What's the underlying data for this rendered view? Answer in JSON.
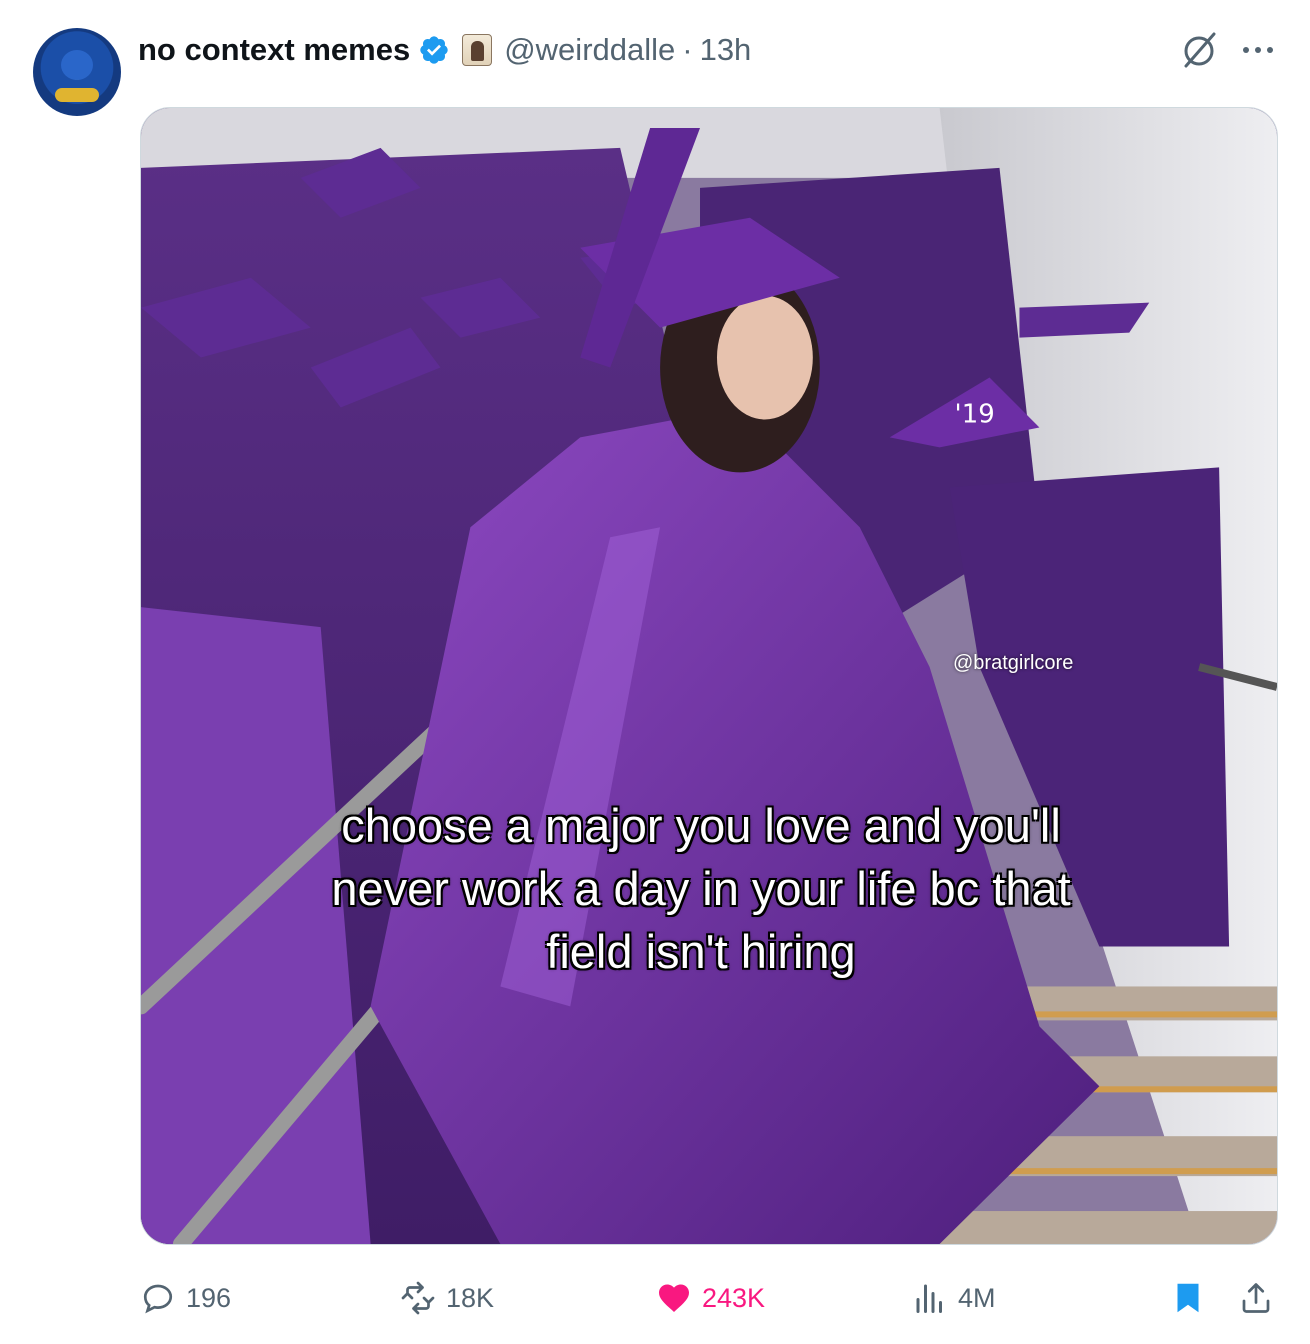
{
  "post": {
    "display_name": "no context memes",
    "handle": "@weirddalle",
    "separator": "·",
    "time": "13h"
  },
  "media": {
    "watermark": "@bratgirlcore",
    "caption": "choose a major you love and you'll never work a day in your life bc that field isn't hiring",
    "cap_number": "'19"
  },
  "actions": {
    "replies": "196",
    "reposts": "18K",
    "likes": "243K",
    "views": "4M"
  },
  "colors": {
    "verified": "#1d9bf0",
    "like": "#f91880",
    "bookmark": "#1d9bf0",
    "secondary_text": "#536471",
    "gown_purple": "#6a2ea0"
  },
  "icons": {
    "verified": "verified-badge-icon",
    "affiliate": "affiliate-badge-icon",
    "grok": "grok-icon",
    "more": "more-icon",
    "reply": "reply-icon",
    "repost": "repost-icon",
    "like": "heart-icon",
    "views": "views-icon",
    "bookmark": "bookmark-icon",
    "share": "share-icon"
  }
}
